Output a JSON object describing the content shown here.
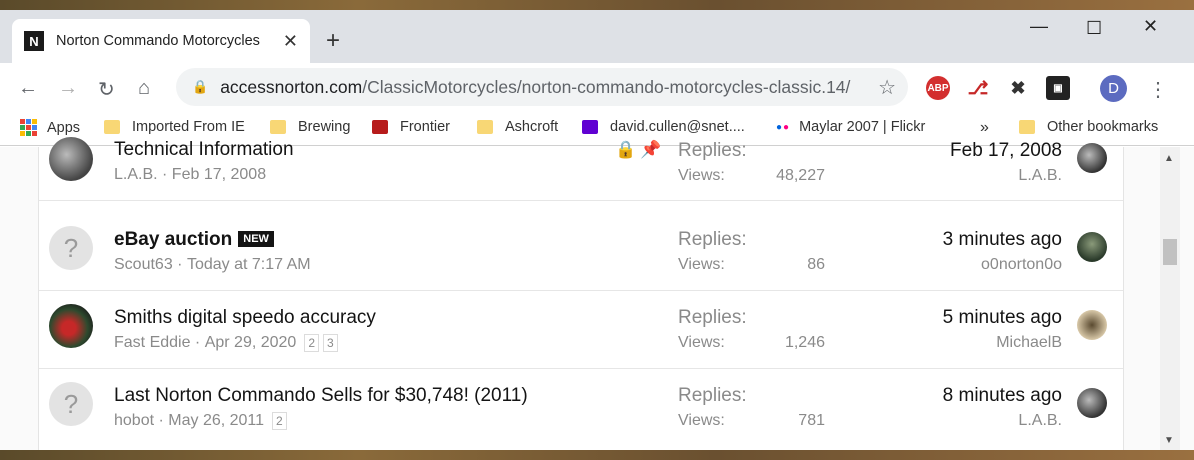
{
  "browser": {
    "tab_title": "Norton Commando Motorcycles",
    "tab_favicon": "N",
    "url_host": "accessnorton.com",
    "url_path": "/ClassicMotorcycles/norton-commando-motorcycles-classic.14/",
    "profile_initial": "D",
    "extensions": [
      "ABP",
      "Acrobat",
      "X",
      "Screenshot"
    ]
  },
  "bookmarks": {
    "apps": "Apps",
    "items": [
      "Imported From IE",
      "Brewing",
      "Frontier",
      "Ashcroft",
      "david.cullen@snet....",
      "Maylar 2007 | Flickr"
    ],
    "overflow": "»",
    "other": "Other bookmarks"
  },
  "threads": [
    {
      "title": "Technical Information",
      "author": "L.A.B.",
      "date": "Feb 17, 2008",
      "replies_label": "Replies:",
      "views_label": "Views:",
      "views": "48,227",
      "last_time": "Feb 17, 2008",
      "last_user": "L.A.B.",
      "icons": "lock-pin"
    },
    {
      "title": "eBay auction",
      "badge": "NEW",
      "author": "Scout63",
      "date": "Today at 7:17 AM",
      "replies_label": "Replies:",
      "views_label": "Views:",
      "views": "86",
      "last_time": "3 minutes ago",
      "last_user": "o0norton0o",
      "avatar_placeholder": "?"
    },
    {
      "title": "Smiths digital speedo accuracy",
      "author": "Fast Eddie",
      "date": "Apr 29, 2020",
      "pages": [
        "2",
        "3"
      ],
      "replies_label": "Replies:",
      "views_label": "Views:",
      "views": "1,246",
      "last_time": "5 minutes ago",
      "last_user": "MichaelB"
    },
    {
      "title": "Last Norton Commando Sells for $30,748! (2011)",
      "author": "hobot",
      "date": "May 26, 2011",
      "pages": [
        "2"
      ],
      "replies_label": "Replies:",
      "views_label": "Views:",
      "views": "781",
      "last_time": "8 minutes ago",
      "last_user": "L.A.B.",
      "avatar_placeholder": "?"
    }
  ],
  "colors": {
    "tabstrip": "#dee1e6",
    "omnibox": "#f1f3f4",
    "profile": "#5c6bc0",
    "folder": "#f8d775"
  }
}
